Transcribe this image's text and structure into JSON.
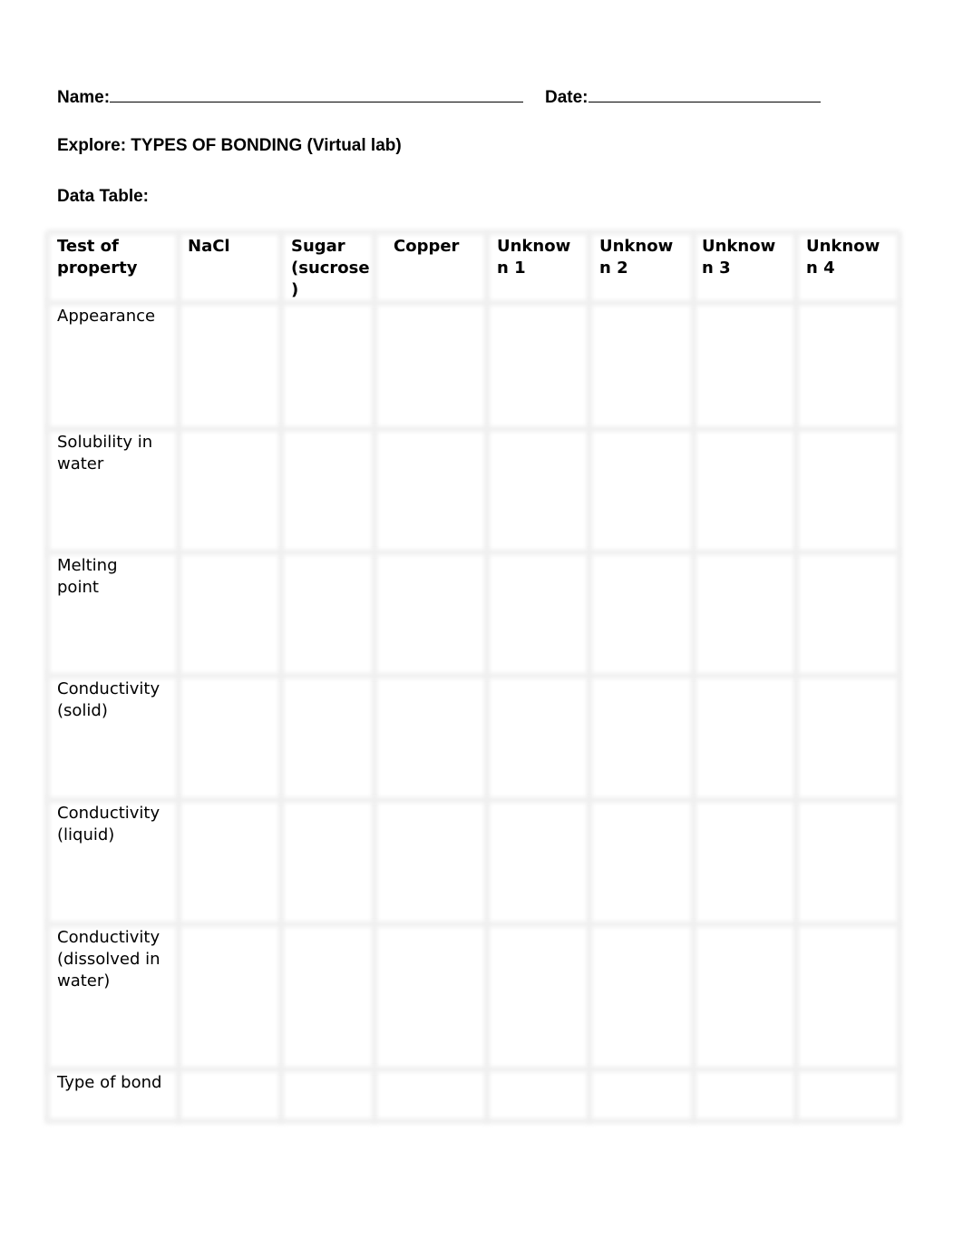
{
  "header": {
    "name_label": "Name:",
    "date_label": "Date:",
    "title": "Explore: TYPES OF BONDING (Virtual lab)",
    "data_table_label": "Data Table:"
  },
  "table": {
    "columns": [
      "Test of\nproperty",
      "NaCl",
      "Sugar\n(sucrose\n)",
      "Copper",
      "Unknow\nn 1",
      "Unknow\nn 2",
      "Unknow\nn 3",
      "Unknow\nn 4"
    ],
    "rows": [
      {
        "label": "Appearance",
        "cells": [
          "",
          "",
          "",
          "",
          "",
          "",
          ""
        ]
      },
      {
        "label": "Solubility in\nwater",
        "cells": [
          "",
          "",
          "",
          "",
          "",
          "",
          ""
        ]
      },
      {
        "label": "Melting\npoint",
        "cells": [
          "",
          "",
          "",
          "",
          "",
          "",
          ""
        ]
      },
      {
        "label": "Conductivity\n(solid)",
        "cells": [
          "",
          "",
          "",
          "",
          "",
          "",
          ""
        ]
      },
      {
        "label": "Conductivity\n(liquid)",
        "cells": [
          "",
          "",
          "",
          "",
          "",
          "",
          ""
        ]
      },
      {
        "label": "Conductivity\n(dissolved in\nwater)",
        "cells": [
          "",
          "",
          "",
          "",
          "",
          "",
          ""
        ]
      },
      {
        "label": "Type of bond",
        "cells": [
          "",
          "",
          "",
          "",
          "",
          "",
          ""
        ]
      }
    ]
  }
}
